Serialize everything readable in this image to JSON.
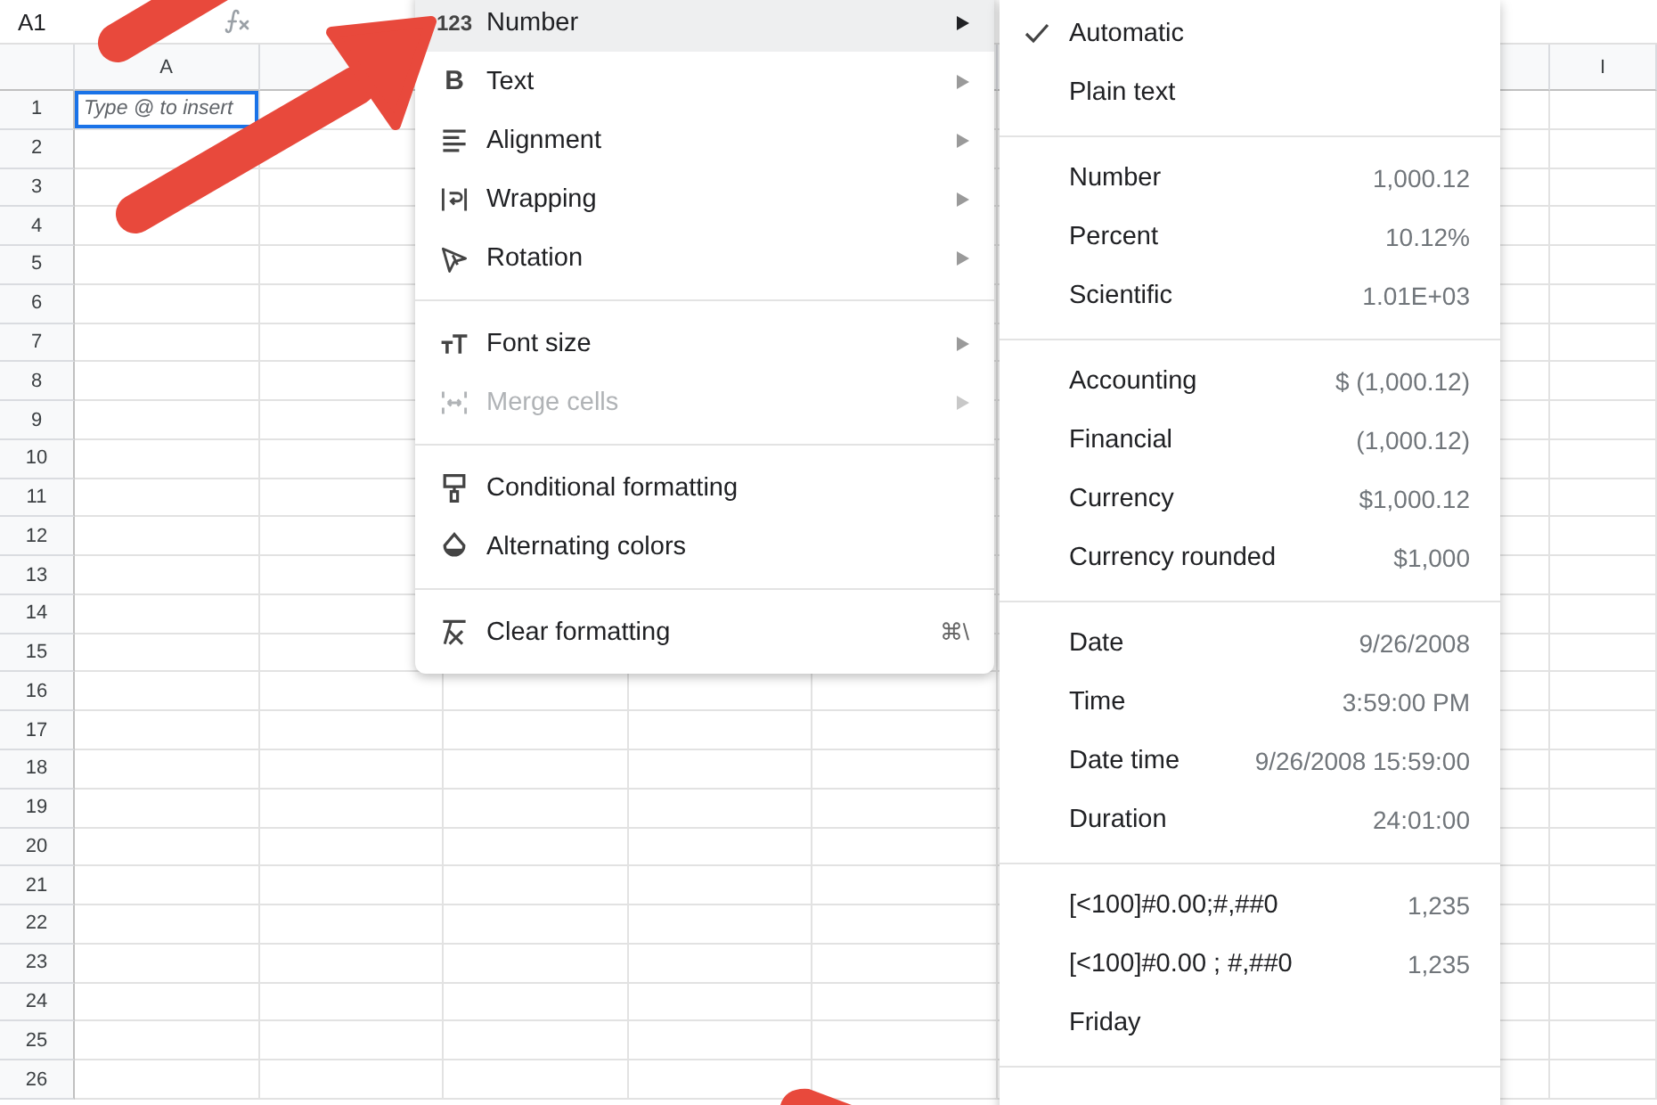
{
  "name_box": "A1",
  "columns": [
    "A",
    "I"
  ],
  "rows": [
    "1",
    "2",
    "3",
    "4",
    "5",
    "6",
    "7",
    "8",
    "9",
    "10",
    "11",
    "12",
    "13",
    "14",
    "15",
    "16",
    "17",
    "18",
    "19",
    "20",
    "21",
    "22",
    "23",
    "24",
    "25",
    "26"
  ],
  "active_cell": {
    "placeholder": "Type @ to insert"
  },
  "format_menu": {
    "groups": [
      [
        {
          "glyph": "123",
          "label": "Number",
          "submenu": true,
          "highlighted": true,
          "disabled": false
        },
        {
          "glyph": "B",
          "label": "Text",
          "submenu": true,
          "highlighted": false,
          "disabled": false
        },
        {
          "label": "Alignment",
          "submenu": true,
          "highlighted": false,
          "disabled": false
        },
        {
          "label": "Wrapping",
          "submenu": true,
          "highlighted": false,
          "disabled": false
        },
        {
          "label": "Rotation",
          "submenu": true,
          "highlighted": false,
          "disabled": false
        }
      ],
      [
        {
          "label": "Font size",
          "submenu": true,
          "highlighted": false,
          "disabled": false
        },
        {
          "label": "Merge cells",
          "submenu": true,
          "highlighted": false,
          "disabled": true
        }
      ],
      [
        {
          "label": "Conditional formatting",
          "submenu": false,
          "highlighted": false,
          "disabled": false
        },
        {
          "label": "Alternating colors",
          "submenu": false,
          "highlighted": false,
          "disabled": false
        }
      ],
      [
        {
          "label": "Clear formatting",
          "submenu": false,
          "highlighted": false,
          "disabled": false,
          "shortcut": "⌘\\"
        }
      ]
    ]
  },
  "number_submenu": {
    "groups": [
      [
        {
          "label": "Automatic",
          "checked": true
        },
        {
          "label": "Plain text",
          "checked": false
        }
      ],
      [
        {
          "label": "Number",
          "value": "1,000.12",
          "checked": false
        },
        {
          "label": "Percent",
          "value": "10.12%",
          "checked": false
        },
        {
          "label": "Scientific",
          "value": "1.01E+03",
          "checked": false
        }
      ],
      [
        {
          "label": "Accounting",
          "value": "$ (1,000.12)",
          "checked": false
        },
        {
          "label": "Financial",
          "value": "(1,000.12)",
          "checked": false
        },
        {
          "label": "Currency",
          "value": "$1,000.12",
          "checked": false
        },
        {
          "label": "Currency rounded",
          "value": "$1,000",
          "checked": false
        }
      ],
      [
        {
          "label": "Date",
          "value": "9/26/2008",
          "checked": false
        },
        {
          "label": "Time",
          "value": "3:59:00 PM",
          "checked": false
        },
        {
          "label": "Date time",
          "value": "9/26/2008 15:59:00",
          "checked": false
        },
        {
          "label": "Duration",
          "value": "24:01:00",
          "checked": false
        }
      ],
      [
        {
          "label": "[<100]#0.00;#,##0",
          "value": "1,235",
          "checked": false
        },
        {
          "label": "[<100]#0.00 ; #,##0",
          "value": "1,235",
          "checked": false
        },
        {
          "label": "Friday",
          "checked": false
        }
      ]
    ]
  }
}
